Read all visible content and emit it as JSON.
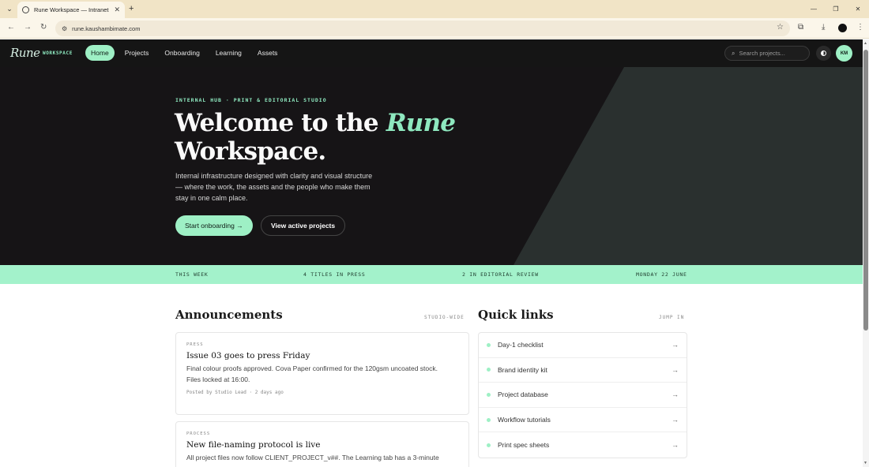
{
  "browser": {
    "tab_title": "Rune Workspace — Intranet",
    "new_tab_icon": "+",
    "url": "rune.kaushambimate.com",
    "colors": {
      "tabbar": "#f1e4c6",
      "toolbar": "#fbf6ea"
    }
  },
  "site": {
    "logo": "Rune",
    "logo_sub": "WORKSPACE",
    "nav": [
      {
        "label": "Home",
        "active": true
      },
      {
        "label": "Projects",
        "active": false
      },
      {
        "label": "Onboarding",
        "active": false
      },
      {
        "label": "Learning",
        "active": false
      },
      {
        "label": "Assets",
        "active": false
      }
    ],
    "search_placeholder": "Search projects...",
    "avatar_initials": "KM",
    "accent_color": "#9ef0c5"
  },
  "hero": {
    "eyebrow": "INTERNAL HUB · PRINT & EDITORIAL STUDIO",
    "title_prefix": "Welcome to the ",
    "title_accent": "Rune",
    "title_suffix": "Workspace.",
    "description": "Internal infrastructure designed with clarity and visual structure — where the work, the assets and the people who make them stay in one calm place.",
    "primary_button": "Start onboarding →",
    "secondary_button": "View active projects"
  },
  "strip": {
    "items": [
      "THIS WEEK",
      "4 TITLES IN PRESS",
      "2 IN EDITORIAL REVIEW",
      "MONDAY 22 JUNE"
    ]
  },
  "announcements": {
    "title": "Announcements",
    "meta": "STUDIO-WIDE",
    "cards": [
      {
        "tag": "PRESS",
        "title": "Issue 03 goes to press Friday",
        "body": "Final colour proofs approved. Cova Paper confirmed for the 120gsm uncoated stock.\nFiles locked at 16:00.",
        "meta": "Posted by Studio Lead · 2 days ago"
      },
      {
        "tag": "PROCESS",
        "title": "New file-naming protocol is live",
        "body": "All project files now follow CLIENT_PROJECT_v##. The Learning tab has a 3-minute",
        "meta": ""
      }
    ]
  },
  "quick_links": {
    "title": "Quick links",
    "meta": "JUMP IN",
    "items": [
      {
        "label": "Day-1 checklist",
        "arrow": "→"
      },
      {
        "label": "Brand identity kit",
        "arrow": "→"
      },
      {
        "label": "Project database",
        "arrow": "→"
      },
      {
        "label": "Workflow tutorials",
        "arrow": "→"
      },
      {
        "label": "Print spec sheets",
        "arrow": "→"
      }
    ]
  }
}
